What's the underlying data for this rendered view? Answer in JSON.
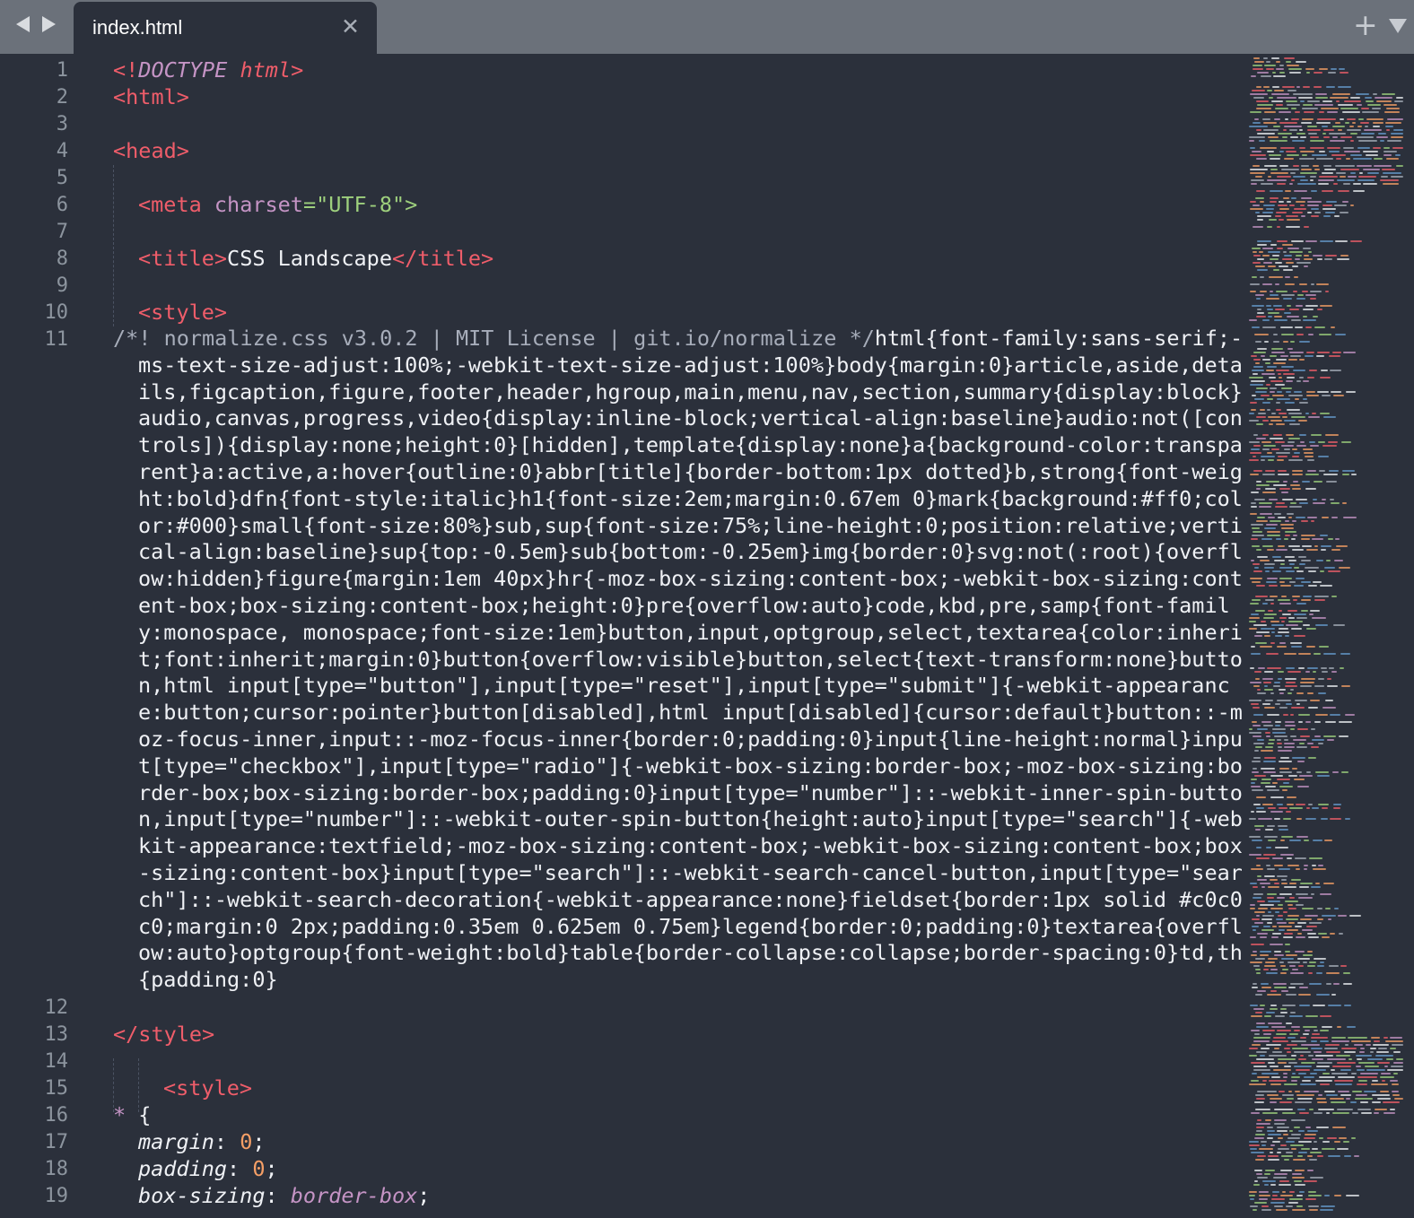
{
  "window": {
    "tab_title": "index.html"
  },
  "gutter": {
    "line_numbers": [
      "1",
      "2",
      "3",
      "4",
      "5",
      "6",
      "7",
      "8",
      "9",
      "10",
      "11",
      "12",
      "13",
      "14",
      "15",
      "16",
      "17",
      "18",
      "19"
    ]
  },
  "code": {
    "l1_a": "<!",
    "l1_b": "DOCTYPE",
    "l1_c": "html",
    "l1_d": ">",
    "l2": "<html>",
    "l4": "<head>",
    "l6_a": "<meta",
    "l6_b": "charset",
    "l6_c": "=\"",
    "l6_d": "UTF-8",
    "l6_e": "\">",
    "l8_a": "<title>",
    "l8_b": "CSS Landscape",
    "l8_c": "</title>",
    "l10": "<style>",
    "l11_comment": "/*! normalize.css v3.0.2 | MIT License | git.io/normalize */",
    "l11_rest": "html{font-family:sans-serif;-ms-text-size-adjust:100%;-webkit-text-size-adjust:100%}body{margin:0}article,aside,details,figcaption,figure,footer,header,hgroup,main,menu,nav,section,summary{display:block}audio,canvas,progress,video{display:inline-block;vertical-align:baseline}audio:not([controls]){display:none;height:0}[hidden],template{display:none}a{background-color:transparent}a:active,a:hover{outline:0}abbr[title]{border-bottom:1px dotted}b,strong{font-weight:bold}dfn{font-style:italic}h1{font-size:2em;margin:0.67em 0}mark{background:#ff0;color:#000}small{font-size:80%}sub,sup{font-size:75%;line-height:0;position:relative;vertical-align:baseline}sup{top:-0.5em}sub{bottom:-0.25em}img{border:0}svg:not(:root){overflow:hidden}figure{margin:1em 40px}hr{-moz-box-sizing:content-box;-webkit-box-sizing:content-box;box-sizing:content-box;height:0}pre{overflow:auto}code,kbd,pre,samp{font-family:monospace, monospace;font-size:1em}button,input,optgroup,select,textarea{color:inherit;font:inherit;margin:0}button{overflow:visible}button,select{text-transform:none}button,html input[type=\"button\"],input[type=\"reset\"],input[type=\"submit\"]{-webkit-appearance:button;cursor:pointer}button[disabled],html input[disabled]{cursor:default}button::-moz-focus-inner,input::-moz-focus-inner{border:0;padding:0}input{line-height:normal}input[type=\"checkbox\"],input[type=\"radio\"]{-webkit-box-sizing:border-box;-moz-box-sizing:border-box;box-sizing:border-box;padding:0}input[type=\"number\"]::-webkit-inner-spin-button,input[type=\"number\"]::-webkit-outer-spin-button{height:auto}input[type=\"search\"]{-webkit-appearance:textfield;-moz-box-sizing:content-box;-webkit-box-sizing:content-box;box-sizing:content-box}input[type=\"search\"]::-webkit-search-cancel-button,input[type=\"search\"]::-webkit-search-decoration{-webkit-appearance:none}fieldset{border:1px solid #c0c0c0;margin:0 2px;padding:0.35em 0.625em 0.75em}legend{border:0;padding:0}textarea{overflow:auto}optgroup{font-weight:bold}table{border-collapse:collapse;border-spacing:0}td,th{padding:0}",
    "l13": "</style>",
    "l15": "<style>",
    "l16_a": "*",
    "l16_b": " {",
    "l17_a": "margin",
    "l17_b": ": ",
    "l17_c": "0",
    "l17_d": ";",
    "l18_a": "padding",
    "l18_b": ": ",
    "l18_c": "0",
    "l18_d": ";",
    "l19_a": "box-sizing",
    "l19_b": ": ",
    "l19_c": "border-box",
    "l19_d": ";"
  },
  "colors": {
    "background": "#2b303b",
    "tabbar": "#6b717a",
    "tag": "#ef5d6a",
    "string": "#9ed07d",
    "number": "#f59f66",
    "keyword": "#c594c5",
    "vendor": "#6699cc",
    "comment": "#a7adba"
  },
  "icons": [
    "back-arrow-icon",
    "forward-arrow-icon",
    "close-icon",
    "plus-icon",
    "chevron-down-icon"
  ]
}
